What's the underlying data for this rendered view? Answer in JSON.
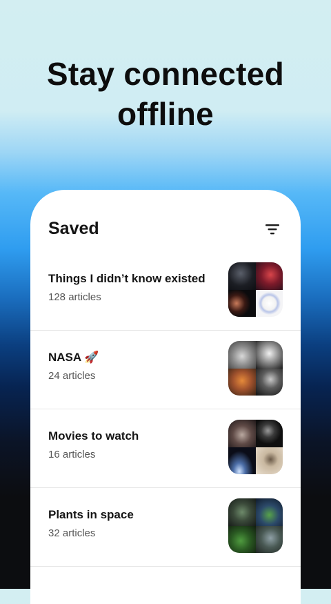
{
  "headline": {
    "line1": "Stay connected",
    "line2": "offline"
  },
  "card": {
    "title": "Saved",
    "filter_icon": "filter-icon",
    "lists": [
      {
        "name": "Things I didn’t know existed",
        "count": "128 articles"
      },
      {
        "name": "NASA 🚀",
        "count": "24 articles"
      },
      {
        "name": "Movies to watch",
        "count": "16 articles"
      },
      {
        "name": "Plants in space",
        "count": "32 articles"
      }
    ]
  }
}
